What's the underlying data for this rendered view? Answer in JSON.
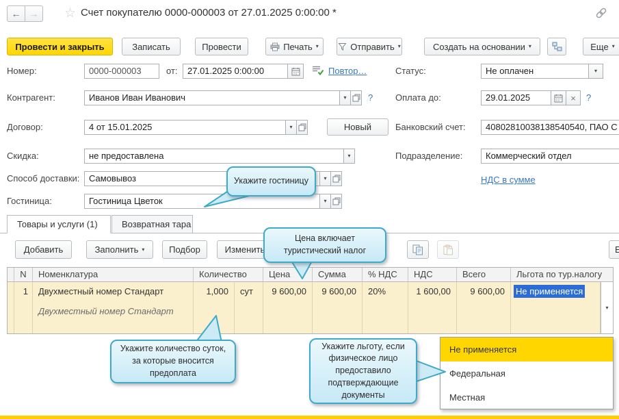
{
  "window": {
    "title": "Счет покупателю 0000-000003 от 27.01.2025 0:00:00 *"
  },
  "toolbar": {
    "post_and_close": "Провести и закрыть",
    "save": "Записать",
    "post": "Провести",
    "print": "Печать",
    "send": "Отправить",
    "create_based_on": "Создать на основании",
    "more": "Еще"
  },
  "form": {
    "number_label": "Номер:",
    "number_value": "0000-000003",
    "date_label": "от:",
    "date_value": "27.01.2025  0:00:00",
    "repeat_link": "Повтор…",
    "status_label": "Статус:",
    "status_value": "Не оплачен",
    "counterparty_label": "Контрагент:",
    "counterparty_value": "Иванов Иван Иванович",
    "help": "?",
    "clear": "×",
    "pay_until_label": "Оплата до:",
    "pay_until_value": "29.01.2025",
    "contract_label": "Договор:",
    "contract_value": "4 от 15.01.2025",
    "new_button": "Новый",
    "bank_account_label": "Банковский счет:",
    "bank_account_value": "40802810038138540540, ПАО С",
    "discount_label": "Скидка:",
    "discount_value": "не предоставлена",
    "department_label": "Подразделение:",
    "department_value": "Коммерческий отдел",
    "delivery_label": "Способ доставки:",
    "delivery_value": "Самовывоз",
    "hotel_label": "Гостиница:",
    "hotel_value": "Гостиница Цветок",
    "vat_link": "НДС в сумме"
  },
  "tabs": {
    "goods": "Товары и услуги (1)",
    "tare": "Возвратная тара"
  },
  "table_toolbar": {
    "add": "Добавить",
    "fill": "Заполнить",
    "pick": "Подбор",
    "edit": "Изменить",
    "more": "Еще"
  },
  "table": {
    "headers": {
      "n": "N",
      "nomenclature": "Номенклатура",
      "qty": "Количество",
      "price": "Цена",
      "sum": "Сумма",
      "vat_rate": "% НДС",
      "vat": "НДС",
      "total": "Всего",
      "benefit": "Льгота по тур.налогу"
    },
    "row": {
      "n": "1",
      "nomenclature": "Двухместный номер Стандарт",
      "content": "Двухместный номер Стандарт",
      "qty": "1,000",
      "unit": "сут",
      "price": "9 600,00",
      "sum": "9 600,00",
      "vat_rate": "20%",
      "vat": "1 600,00",
      "total": "9 600,00",
      "benefit": "Не применяется"
    }
  },
  "benefit_dropdown": {
    "options": [
      "Не применяется",
      "Федеральная",
      "Местная"
    ]
  },
  "callouts": {
    "hotel": "Укажите гостиницу",
    "price": "Цена включает туристический налог",
    "qty": "Укажите количество суток, за которые вносится предоплата",
    "benefit": "Укажите льготу, если физическое лицо предоставило подтверждающие документы"
  },
  "colors": {
    "accent_yellow": "#ffd600",
    "selection_blue": "#2b6cd9",
    "link_blue": "#3779be",
    "callout_border": "#3fa9c9",
    "callout_bg": "#d4eef8",
    "row_bg": "#fbf0cd"
  }
}
